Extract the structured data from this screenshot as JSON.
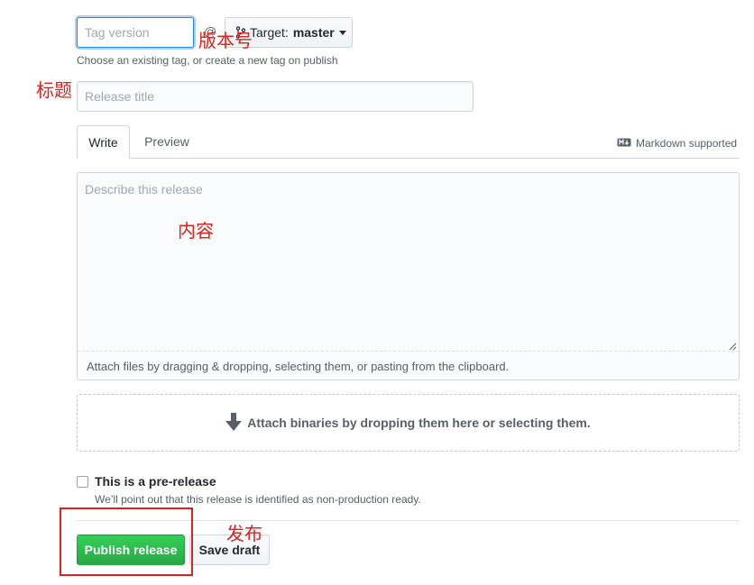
{
  "form": {
    "tag_placeholder": "Tag version",
    "target_label": "Target:",
    "target_value": "master",
    "tag_hint": "Choose an existing tag, or create a new tag on publish",
    "title_placeholder": "Release title",
    "tabs": [
      {
        "label": "Write",
        "active": true
      },
      {
        "label": "Preview",
        "active": false
      }
    ],
    "markdown_supported": "Markdown supported",
    "description_placeholder": "Describe this release",
    "attach_files": "Attach files by dragging & dropping, selecting them, or pasting from the clipboard.",
    "binaries_text": "Attach binaries by dropping them here or selecting them.",
    "prerelease_label": "This is a pre-release",
    "prerelease_note": "We’ll point out that this release is identified as non-production ready.",
    "publish_label": "Publish release",
    "save_draft_label": "Save draft"
  },
  "annotations": {
    "version": "版本号",
    "title": "标题",
    "content": "内容",
    "publish": "发布",
    "color": "#e0201b"
  },
  "icons": {
    "at": "at-icon",
    "branch": "git-branch-icon",
    "caret": "caret-down-icon",
    "markdown": "markdown-icon",
    "arrow": "arrow-down-icon"
  },
  "colors": {
    "accent_focus": "#2188ff",
    "publish_green": "#28a745"
  }
}
